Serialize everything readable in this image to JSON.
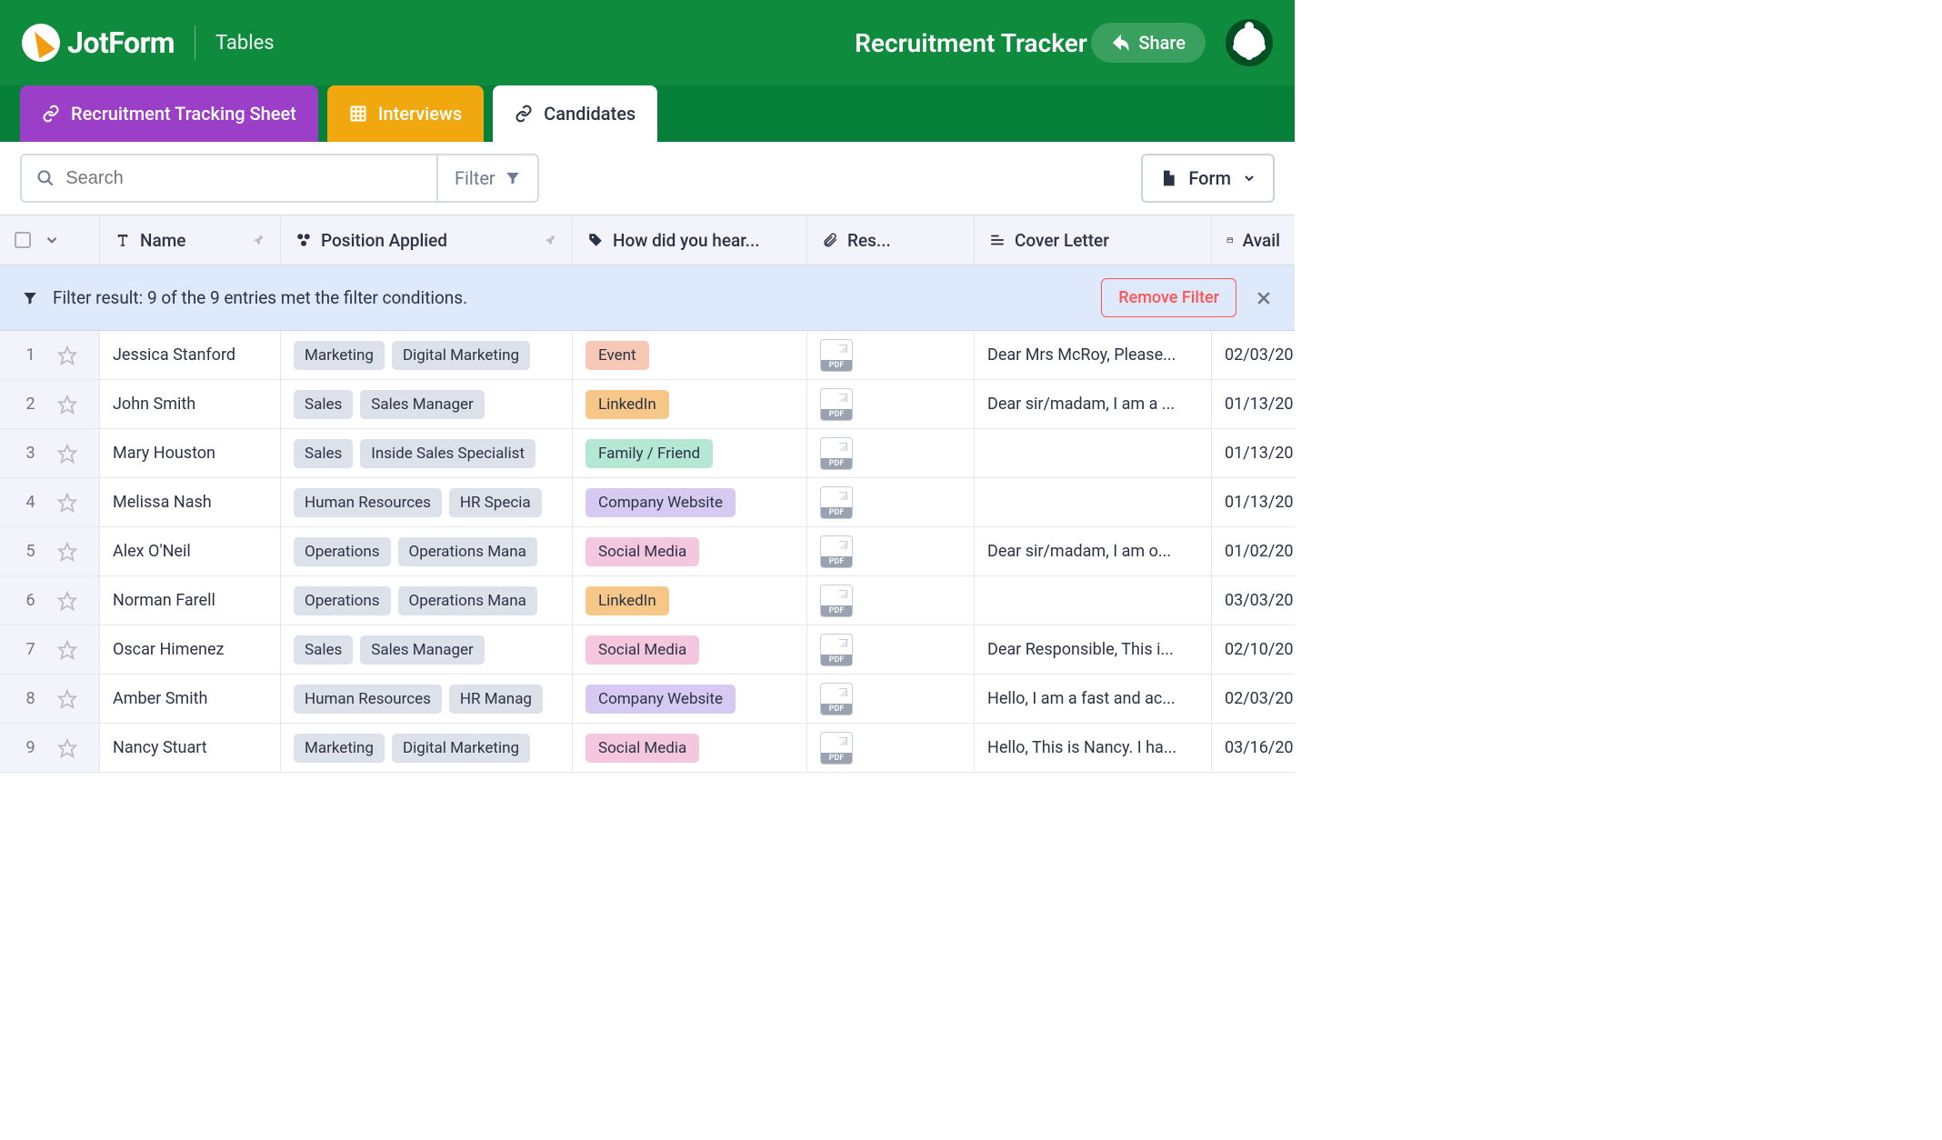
{
  "header": {
    "brand": "JotForm",
    "section": "Tables",
    "title": "Recruitment Tracker",
    "share": "Share"
  },
  "tabs": [
    {
      "label": "Recruitment Tracking Sheet",
      "icon": "link",
      "color": "purple"
    },
    {
      "label": "Interviews",
      "icon": "grid",
      "color": "orange"
    },
    {
      "label": "Candidates",
      "icon": "link",
      "color": "white"
    }
  ],
  "toolbar": {
    "search_placeholder": "Search",
    "filter_label": "Filter",
    "form_label": "Form"
  },
  "columns": {
    "name": "Name",
    "position": "Position Applied",
    "hear": "How did you hear...",
    "resume": "Res...",
    "cover": "Cover Letter",
    "avail": "Avail"
  },
  "banner": {
    "text": "Filter result: 9 of the 9 entries met the filter conditions.",
    "remove": "Remove Filter"
  },
  "pdf_label": "PDF",
  "chip_colors": {
    "Event": "event",
    "LinkedIn": "linkedin",
    "Family / Friend": "family",
    "Company Website": "company",
    "Social Media": "social"
  },
  "rows": [
    {
      "n": "1",
      "name": "Jessica Stanford",
      "pos": [
        "Marketing",
        "Digital Marketing "
      ],
      "hear": "Event",
      "cover": "Dear Mrs McRoy, Please...",
      "avail": "02/03/20"
    },
    {
      "n": "2",
      "name": "John Smith",
      "pos": [
        "Sales",
        "Sales Manager"
      ],
      "hear": "LinkedIn",
      "cover": "Dear sir/madam, I am a ...",
      "avail": "01/13/20"
    },
    {
      "n": "3",
      "name": "Mary Houston",
      "pos": [
        "Sales",
        "Inside Sales Specialist"
      ],
      "hear": "Family / Friend",
      "cover": "",
      "avail": "01/13/20"
    },
    {
      "n": "4",
      "name": "Melissa Nash",
      "pos": [
        "Human Resources",
        "HR Specia"
      ],
      "hear": "Company Website",
      "cover": "",
      "avail": "01/13/20"
    },
    {
      "n": "5",
      "name": "Alex O'Neil",
      "pos": [
        "Operations",
        "Operations Mana"
      ],
      "hear": "Social Media",
      "cover": "Dear sir/madam, I am o...",
      "avail": "01/02/20"
    },
    {
      "n": "6",
      "name": "Norman Farell",
      "pos": [
        "Operations",
        "Operations Mana"
      ],
      "hear": "LinkedIn",
      "cover": "",
      "avail": "03/03/20"
    },
    {
      "n": "7",
      "name": "Oscar Himenez",
      "pos": [
        "Sales",
        "Sales Manager"
      ],
      "hear": "Social Media",
      "cover": "Dear Responsible, This i...",
      "avail": "02/10/20"
    },
    {
      "n": "8",
      "name": "Amber Smith",
      "pos": [
        "Human Resources",
        "HR Manag"
      ],
      "hear": "Company Website",
      "cover": "Hello, I am a fast and ac...",
      "avail": "02/03/20"
    },
    {
      "n": "9",
      "name": "Nancy Stuart",
      "pos": [
        "Marketing",
        "Digital Marketing "
      ],
      "hear": "Social Media",
      "cover": "Hello, This is Nancy. I ha...",
      "avail": "03/16/20"
    }
  ]
}
